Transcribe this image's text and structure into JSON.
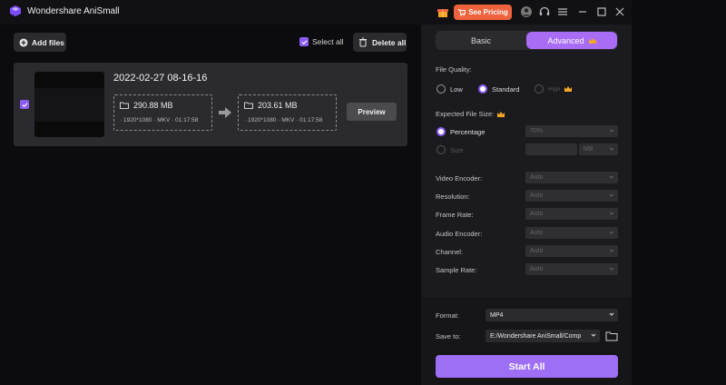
{
  "app": {
    "title": "Wondershare AniSmall",
    "pricing_label": "See Pricing",
    "icons": [
      "app-logo-icon",
      "gift-icon",
      "user-icon",
      "headset-icon",
      "menu-icon",
      "minimize-icon",
      "maximize-icon",
      "close-icon"
    ]
  },
  "toolbar": {
    "add_files": "Add files",
    "select_all": "Select all",
    "delete_all": "Delete all"
  },
  "file": {
    "name": "2022-02-27 08-16-16",
    "source": {
      "size": "290.88 MB",
      "meta": "· 1920*1080 · MKV · 01:17:58"
    },
    "output": {
      "size": "203.61 MB",
      "meta": "· 1920*1080 · MKV · 01:17:58"
    },
    "preview_label": "Preview"
  },
  "settings": {
    "tabs": {
      "basic": "Basic",
      "advanced": "Advanced"
    },
    "file_quality": {
      "label": "File Quality:",
      "options": [
        "Low",
        "Standard",
        "High"
      ],
      "selected": "Standard"
    },
    "expected_size": {
      "label": "Expected File Size:",
      "percentage_label": "Percentage",
      "percentage_value": "70%",
      "size_label": "Size",
      "size_unit": "MB"
    },
    "fields": [
      {
        "label": "Video Encoder:",
        "value": "Auto"
      },
      {
        "label": "Resolution:",
        "value": "Auto"
      },
      {
        "label": "Frame Rate:",
        "value": "Auto"
      },
      {
        "label": "Audio Encoder:",
        "value": "Auto"
      },
      {
        "label": "Channel:",
        "value": "Auto"
      },
      {
        "label": "Sample Rate:",
        "value": "Auto"
      }
    ],
    "format": {
      "label": "Format:",
      "value": "MP4"
    },
    "save_to": {
      "label": "Save to:",
      "value": "E:/Wondershare AniSmall/Comp"
    },
    "start_all": "Start All"
  },
  "colors": {
    "accent": "#8b5cf6",
    "pricing": "#f0623d",
    "panel": "#1b1b1f"
  }
}
